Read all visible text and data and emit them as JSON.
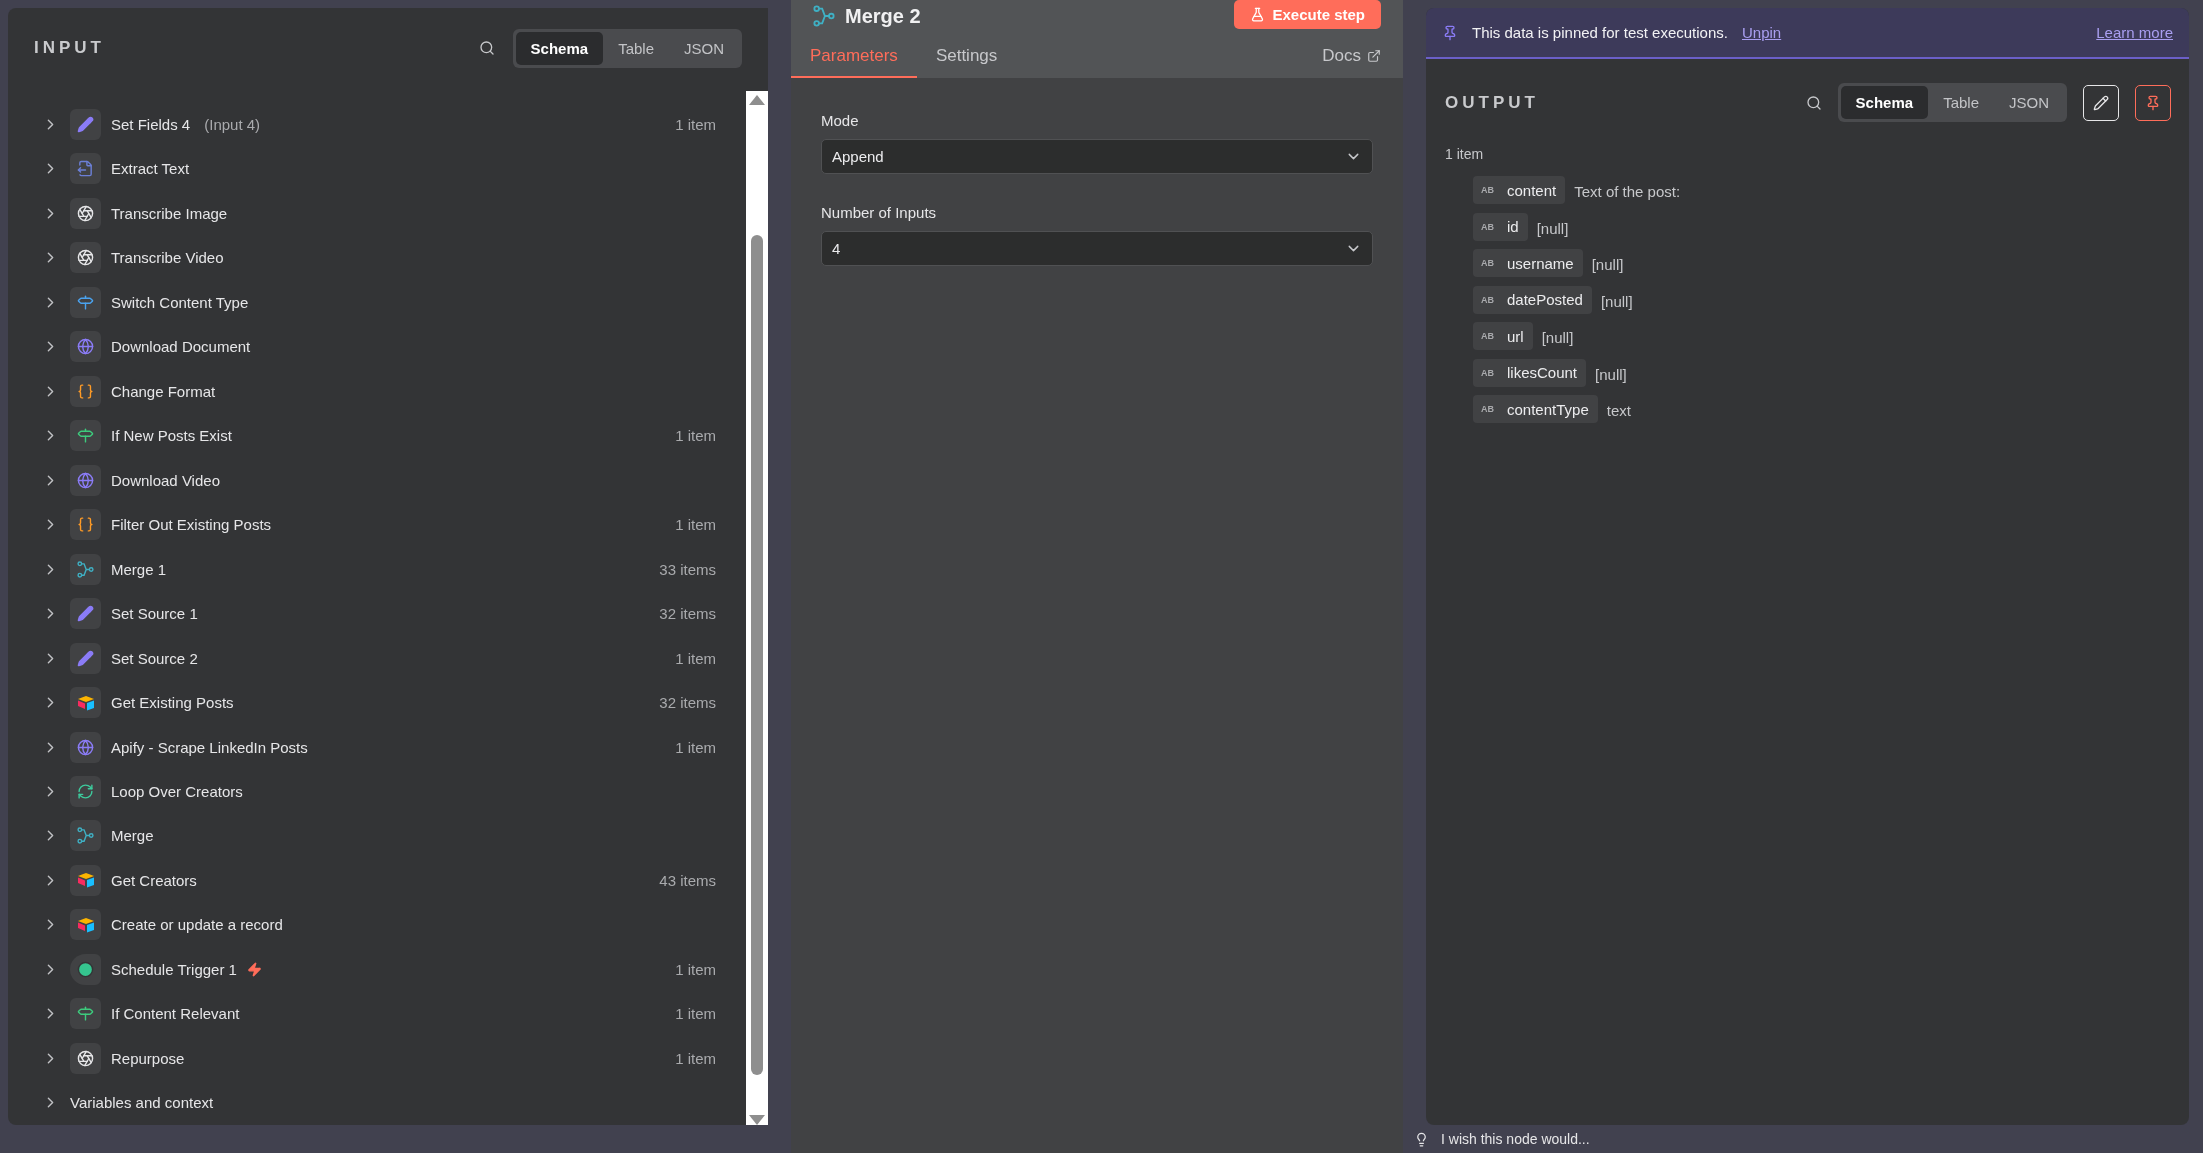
{
  "input_panel": {
    "title": "INPUT",
    "view_tabs": [
      {
        "label": "Schema",
        "selected": true
      },
      {
        "label": "Table",
        "selected": false
      },
      {
        "label": "JSON",
        "selected": false
      }
    ],
    "nodes": [
      {
        "name": "Set Fields 4",
        "note": "(Input 4)",
        "kind": "edit",
        "count": "1 item",
        "trigger": false
      },
      {
        "name": "Extract Text",
        "kind": "extract",
        "trigger": false
      },
      {
        "name": "Transcribe Image",
        "kind": "openai",
        "trigger": false
      },
      {
        "name": "Transcribe Video",
        "kind": "openai",
        "trigger": false
      },
      {
        "name": "Switch Content Type",
        "kind": "switch",
        "trigger": false
      },
      {
        "name": "Download Document",
        "kind": "http",
        "trigger": false
      },
      {
        "name": "Change Format",
        "kind": "code",
        "trigger": false
      },
      {
        "name": "If New Posts Exist",
        "kind": "if",
        "count": "1 item",
        "trigger": false
      },
      {
        "name": "Download Video",
        "kind": "http",
        "trigger": false
      },
      {
        "name": "Filter Out Existing Posts",
        "kind": "code",
        "count": "1 item",
        "trigger": false
      },
      {
        "name": "Merge 1",
        "kind": "merge",
        "count": "33 items",
        "trigger": false
      },
      {
        "name": "Set Source 1",
        "kind": "edit",
        "count": "32 items",
        "trigger": false
      },
      {
        "name": "Set Source 2",
        "kind": "edit",
        "count": "1 item",
        "trigger": false
      },
      {
        "name": "Get Existing Posts",
        "kind": "airtable",
        "count": "32 items",
        "trigger": false
      },
      {
        "name": "Apify - Scrape LinkedIn Posts",
        "kind": "http",
        "count": "1 item",
        "trigger": false
      },
      {
        "name": "Loop Over Creators",
        "kind": "loop",
        "trigger": false
      },
      {
        "name": "Merge",
        "kind": "merge",
        "trigger": false
      },
      {
        "name": "Get Creators",
        "kind": "airtable",
        "count": "43 items",
        "trigger": false
      },
      {
        "name": "Create or update a record",
        "kind": "airtable",
        "trigger": false
      },
      {
        "name": "Schedule Trigger 1",
        "kind": "schedule",
        "count": "1 item",
        "trigger": true
      },
      {
        "name": "If Content Relevant",
        "kind": "if",
        "count": "1 item",
        "trigger": false
      },
      {
        "name": "Repurpose",
        "kind": "openai",
        "count": "1 item",
        "trigger": false
      }
    ],
    "variables_label": "Variables and context"
  },
  "node_panel": {
    "title": "Merge 2",
    "execute_button": "Execute step",
    "tabs": [
      {
        "label": "Parameters",
        "selected": true
      },
      {
        "label": "Settings",
        "selected": false
      }
    ],
    "docs_link": "Docs",
    "fields": [
      {
        "label": "Mode",
        "value": "Append"
      },
      {
        "label": "Number of Inputs",
        "value": "4"
      }
    ]
  },
  "output_panel": {
    "banner": {
      "text": "This data is pinned for test executions.",
      "unpin_link": "Unpin",
      "learn_more_link": "Learn more"
    },
    "title": "OUTPUT",
    "view_tabs": [
      {
        "label": "Schema",
        "selected": true
      },
      {
        "label": "Table",
        "selected": false
      },
      {
        "label": "JSON",
        "selected": false
      }
    ],
    "item_count": "1 item",
    "fields": [
      {
        "type": "AB",
        "name": "content",
        "value": "Text of the post:"
      },
      {
        "type": "AB",
        "name": "id",
        "value": "[null]"
      },
      {
        "type": "AB",
        "name": "username",
        "value": "[null]"
      },
      {
        "type": "AB",
        "name": "datePosted",
        "value": "[null]"
      },
      {
        "type": "AB",
        "name": "url",
        "value": "[null]"
      },
      {
        "type": "AB",
        "name": "likesCount",
        "value": "[null]"
      },
      {
        "type": "AB",
        "name": "contentType",
        "value": "text"
      }
    ]
  },
  "feedback_prompt": "I wish this node would..."
}
